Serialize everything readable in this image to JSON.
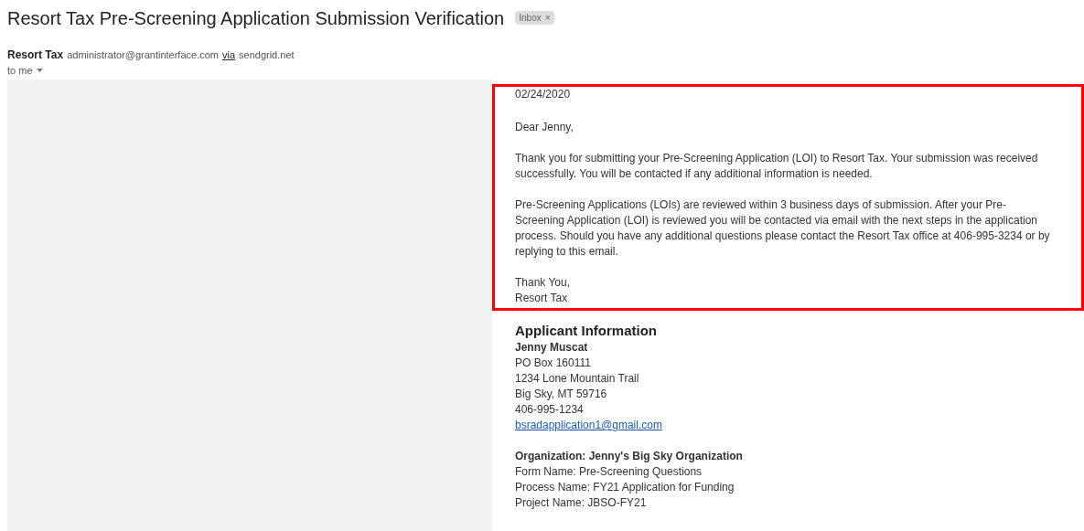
{
  "email": {
    "subject": "Resort Tax Pre-Screening Application Submission Verification",
    "label": {
      "text": "Inbox",
      "close": "×"
    },
    "sender": {
      "name": "Resort Tax",
      "address": "administrator@grantinterface.com",
      "via": "via",
      "domain": "sendgrid.net"
    },
    "recipient": "to me"
  },
  "highlighted_message": {
    "date": "02/24/2020",
    "greeting": "Dear Jenny,",
    "paragraphs": [
      "Thank you for submitting your Pre-Screening Application (LOI) to Resort Tax. Your submission was received successfully. You will be contacted if any additional information is needed.",
      "Pre-Screening Applications (LOIs) are reviewed within 3 business days of submission. After your Pre-Screening Application (LOI) is reviewed you will be contacted via email with the next steps in the application process. Should you have any additional questions please contact the Resort Tax office at 406-995-3234 or by replying to this email."
    ],
    "closing": [
      "Thank You,",
      "Resort Tax"
    ]
  },
  "applicant": {
    "heading": "Applicant Information",
    "name": "Jenny Muscat",
    "lines": [
      "PO Box 160111",
      "1234 Lone Mountain Trail",
      "Big Sky, MT 59716",
      "406-995-1234"
    ],
    "email": "bsradapplication1@gmail.com"
  },
  "organization": {
    "heading": "Organization: Jenny's Big Sky Organization",
    "lines": [
      "Form Name: Pre-Screening Questions",
      "Process Name: FY21 Application for Funding",
      "Project Name: JBSO-FY21"
    ]
  }
}
